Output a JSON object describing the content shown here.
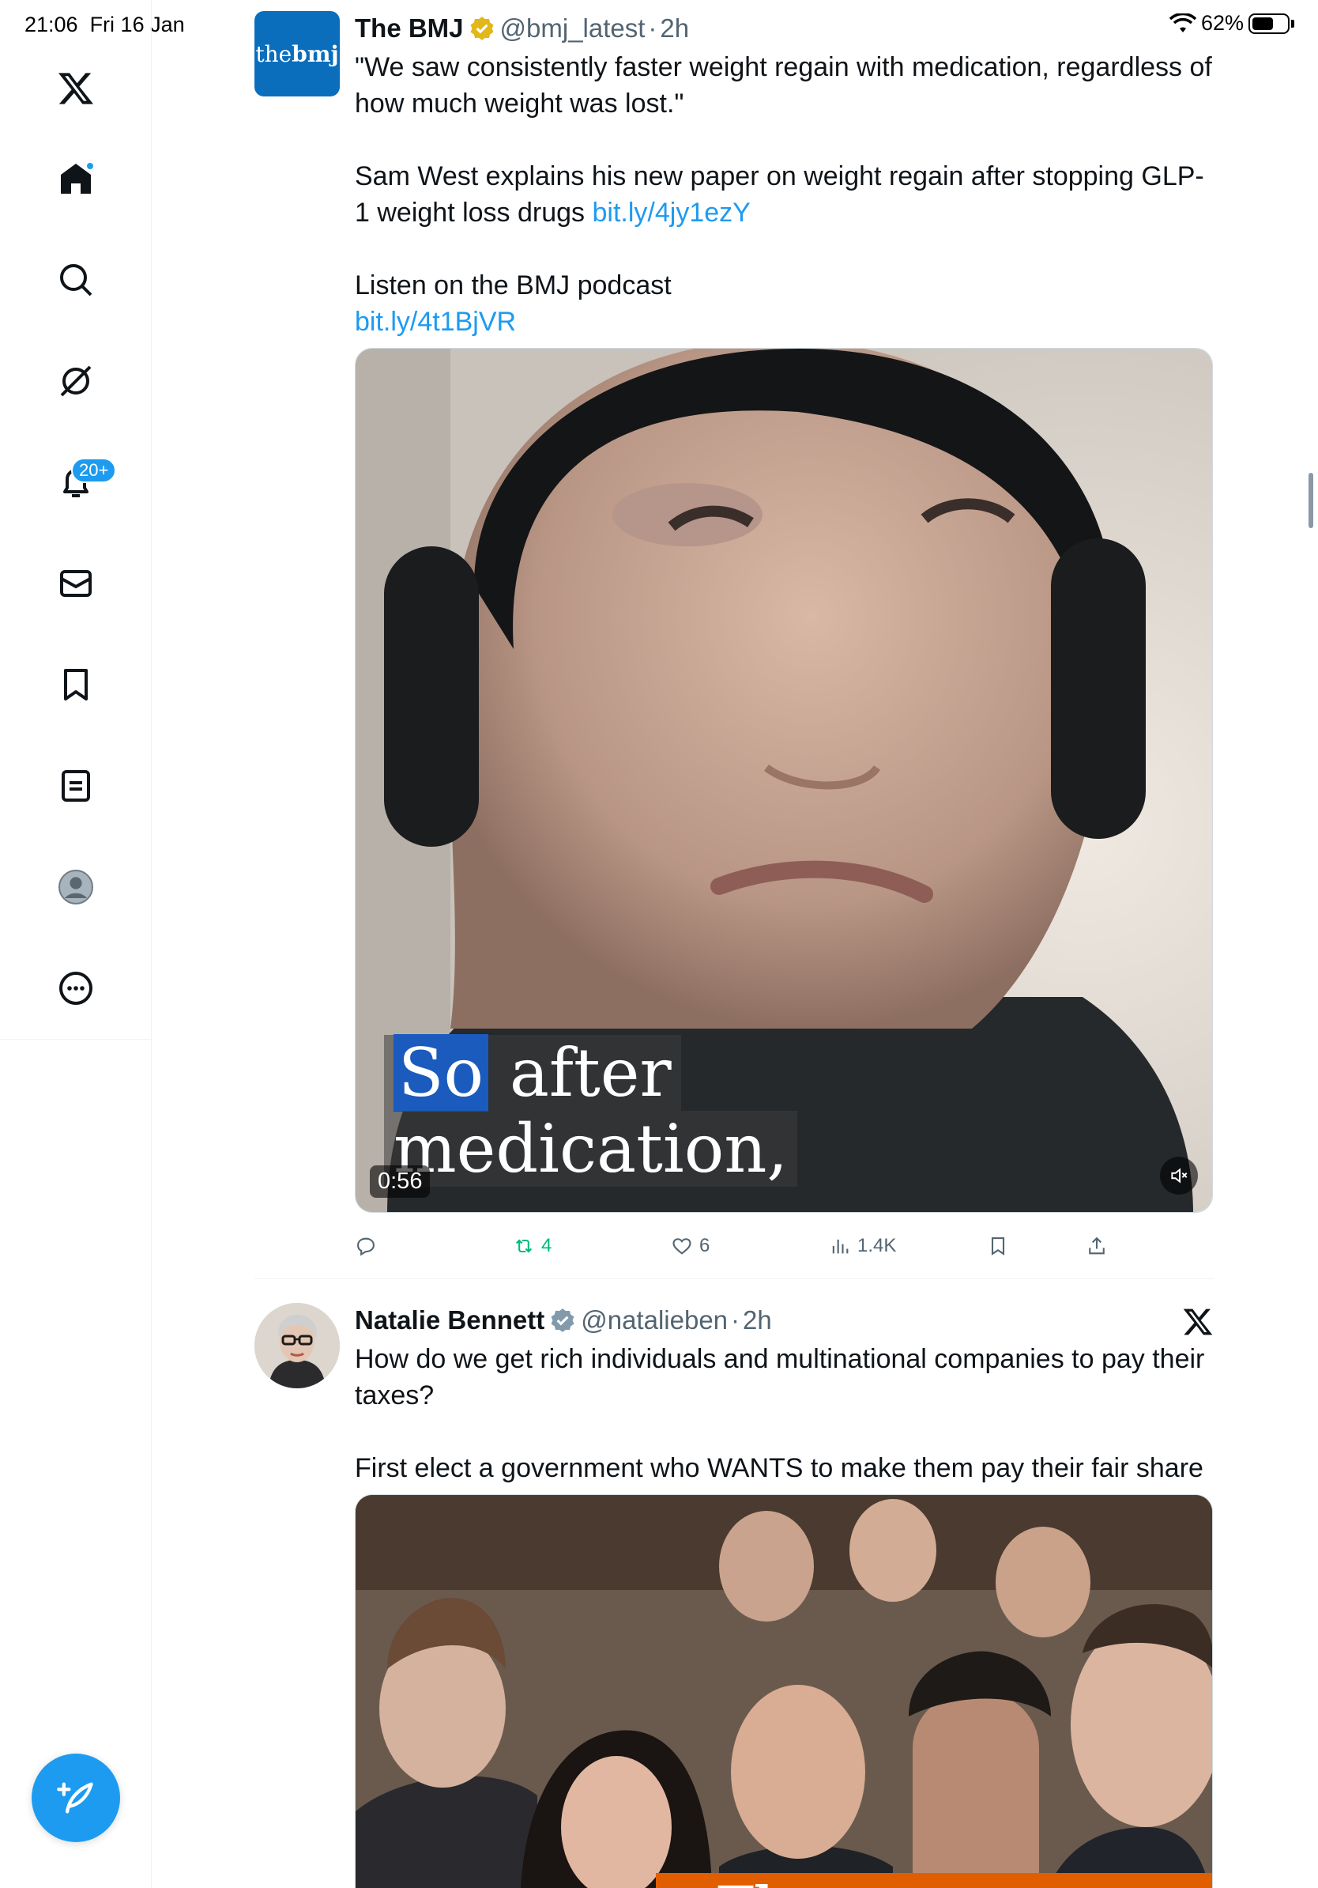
{
  "status_bar": {
    "time_date": "21:06  Fri 16 Jan",
    "battery": "62%",
    "battery_level": 0.62
  },
  "sidebar": {
    "items": [
      {
        "name": "x-logo-icon"
      },
      {
        "name": "home-icon"
      },
      {
        "name": "search-icon"
      },
      {
        "name": "grok-icon"
      },
      {
        "name": "notifications-icon",
        "badge": "20+"
      },
      {
        "name": "messages-icon"
      },
      {
        "name": "bookmarks-icon"
      },
      {
        "name": "lists-icon"
      },
      {
        "name": "profile-icon"
      },
      {
        "name": "more-icon"
      }
    ],
    "compose_icon": "compose-icon"
  },
  "tweets": [
    {
      "avatar_text": "thebmj",
      "display_name": "The BMJ",
      "handle": "@bmj_latest",
      "separator": "·",
      "age": "2h",
      "text": [
        "\"We saw consistently faster weight regain with medication, regardless of how much weight was lost.\"",
        "Sam West explains his new paper on weight regain after stopping GLP-1 weight loss drugs ",
        "bit.ly/4jy1ezY",
        "Listen on the BMJ podcast",
        "bit.ly/4t1BjVR"
      ],
      "video": {
        "caption_so": "So",
        "caption_line1": "after",
        "caption_line2": "medication,",
        "duration": "0:56"
      },
      "actions": {
        "reply": "",
        "retweets": "4",
        "likes": "6",
        "views": "1.4K"
      }
    },
    {
      "display_name": "Natalie Bennett",
      "handle": "@natalieben",
      "separator": "·",
      "age": "2h",
      "text": [
        "How do we get rich individuals and multinational companies to pay their taxes?",
        "First elect a government who WANTS to make them pay their fair share"
      ],
      "image": {
        "tag": "The"
      }
    }
  ],
  "colors": {
    "accent": "#1d9bf0",
    "bmj_blue": "#0a6ebd",
    "retweet_green": "#00ba7c",
    "guardian_orange": "#e05e00",
    "verified_gold": "#e2b719",
    "verified_grey": "#829aab"
  }
}
